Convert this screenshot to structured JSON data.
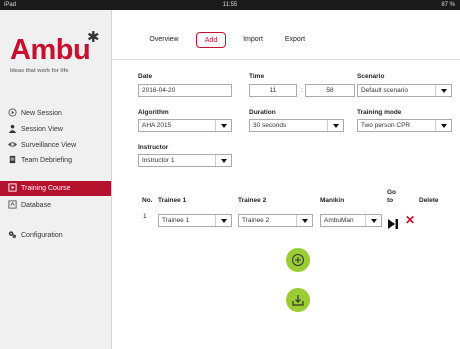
{
  "status_bar": {
    "left": "iPad",
    "center": "11:55",
    "right": "87 %"
  },
  "brand": {
    "name": "Ambu",
    "tagline": "Ideas that work for life"
  },
  "sidebar": {
    "items": [
      {
        "label": "New Session",
        "icon": "play-circle-icon"
      },
      {
        "label": "Session View",
        "icon": "person-icon"
      },
      {
        "label": "Surveillance View",
        "icon": "eye-icon"
      },
      {
        "label": "Team Debriefing",
        "icon": "clipboard-icon"
      },
      {
        "label": "Training Course",
        "icon": "training-course-icon",
        "active": true
      },
      {
        "label": "Database",
        "icon": "database-icon"
      },
      {
        "label": "Configuration",
        "icon": "gears-icon"
      }
    ]
  },
  "tabs": [
    {
      "label": "Overview"
    },
    {
      "label": "Add",
      "active": true
    },
    {
      "label": "Import"
    },
    {
      "label": "Export"
    }
  ],
  "form": {
    "date": {
      "label": "Date",
      "value": "2016-04-20"
    },
    "time": {
      "label": "Time",
      "hours": "11",
      "separator": ":",
      "minutes": "58"
    },
    "scenario": {
      "label": "Scenario",
      "value": "Default scenario"
    },
    "algorithm": {
      "label": "Algorithm",
      "value": "AHA 2015"
    },
    "duration": {
      "label": "Duration",
      "value": "30 seconds"
    },
    "training_mode": {
      "label": "Training mode",
      "value": "Two person CPR"
    },
    "instructor": {
      "label": "Instructor",
      "value": "Instructor 1"
    }
  },
  "table": {
    "headers": {
      "no": "No.",
      "trainee1": "Trainee 1",
      "trainee2": "Trainee 2",
      "manikin": "Manikin",
      "goto_line1": "Go",
      "goto_line2": "to",
      "delete": "Delete"
    },
    "rows": [
      {
        "no": "1",
        "trainee1": "Trainee 1",
        "trainee2": "Trainee 2",
        "manikin": "AmbuMan"
      }
    ]
  },
  "colors": {
    "accent": "#c8102e",
    "action_green": "#9acd32",
    "sidebar_bg": "#f0f0f0"
  }
}
